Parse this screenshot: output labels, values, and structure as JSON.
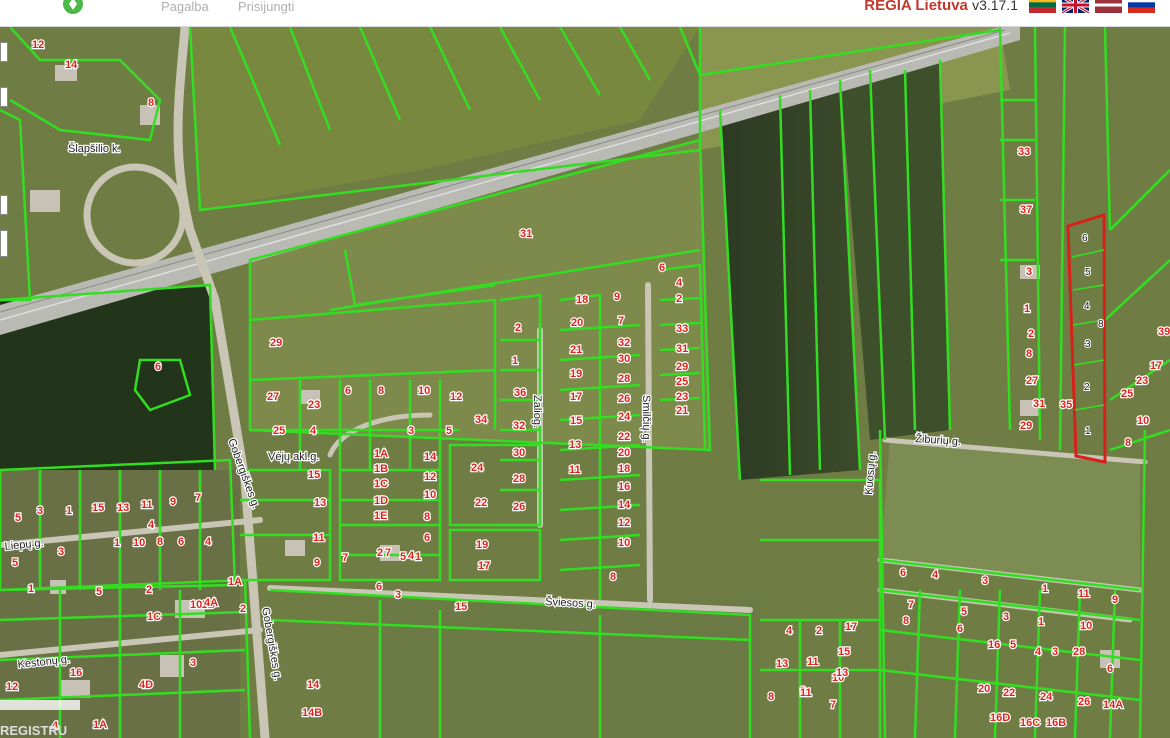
{
  "nav": {
    "help": "Pagalba",
    "login": "Prisijungti"
  },
  "brand": {
    "name": "REGIA Lietuva",
    "version": "v3.17.1"
  },
  "flags": [
    "lt",
    "gb",
    "lv",
    "ru"
  ],
  "colors": {
    "parcel_line": "#33dd22",
    "highlight": "#d6201a",
    "label": "#e0241b"
  },
  "streets": [
    {
      "id": "slapsilio",
      "text": "Šlapšilio k."
    },
    {
      "id": "veju",
      "text": "Vėjų akl.g."
    },
    {
      "id": "liepu",
      "text": "Liepų g."
    },
    {
      "id": "kestucio",
      "text": "Kestonų g."
    },
    {
      "id": "gobergiskes1",
      "text": "Gobergiškes g."
    },
    {
      "id": "gobergiskes2",
      "text": "Gobergiškes g."
    },
    {
      "id": "zalioji",
      "text": "Zaliog."
    },
    {
      "id": "smilciu",
      "text": "Smilčių g."
    },
    {
      "id": "sviesos",
      "text": "Šviesos g."
    },
    {
      "id": "ziburiu",
      "text": "Žiburių g."
    },
    {
      "id": "kuosu",
      "text": "Kuosų g."
    }
  ],
  "parcels": [
    "12",
    "14",
    "8",
    "31",
    "6",
    "29",
    "27",
    "6",
    "8",
    "10",
    "12",
    "23",
    "25",
    "4",
    "3",
    "1A",
    "1B",
    "1C",
    "1D",
    "1E",
    "14",
    "12",
    "10",
    "8",
    "6",
    "4",
    "2",
    "5",
    "15",
    "13",
    "11",
    "9",
    "7",
    "5",
    "3",
    "1",
    "15",
    "13",
    "11",
    "9",
    "7",
    "5",
    "3",
    "1",
    "10",
    "8",
    "6",
    "4",
    "2",
    "1C",
    "1B",
    "1A",
    "1",
    "5",
    "3",
    "2",
    "10",
    "12",
    "16",
    "4D",
    "4",
    "1A",
    "4A",
    "2",
    "1",
    "36",
    "34",
    "32",
    "30",
    "28",
    "26",
    "24",
    "22",
    "18",
    "20",
    "21",
    "19",
    "17",
    "15",
    "13",
    "11",
    "9",
    "7",
    "32",
    "30",
    "28",
    "26",
    "24",
    "22",
    "20",
    "18",
    "16",
    "14",
    "12",
    "10",
    "8",
    "6",
    "4",
    "2",
    "33",
    "31",
    "29",
    "25",
    "23",
    "21",
    "19",
    "17",
    "15",
    "3",
    "1",
    "7",
    "6",
    "5",
    "4",
    "3",
    "2",
    "1",
    "8",
    "27",
    "31",
    "29",
    "35",
    "33",
    "37",
    "39",
    "17",
    "23",
    "25",
    "10",
    "8",
    "6",
    "4",
    "3",
    "1",
    "11",
    "9",
    "7",
    "5",
    "3",
    "1",
    "10",
    "8",
    "6",
    "4",
    "2",
    "17",
    "15",
    "13",
    "11",
    "10",
    "8",
    "9",
    "7",
    "6",
    "5",
    "4",
    "3",
    "28",
    "20",
    "22",
    "24",
    "26",
    "16D",
    "16C",
    "16B",
    "14A",
    "14",
    "14B",
    "16",
    "13",
    "11",
    "10",
    "8",
    "6"
  ],
  "highlighted_parcels": [
    "6",
    "5",
    "4",
    "3",
    "2",
    "1"
  ],
  "highlight_outside_label": "8",
  "watermark": "REGISTRU"
}
